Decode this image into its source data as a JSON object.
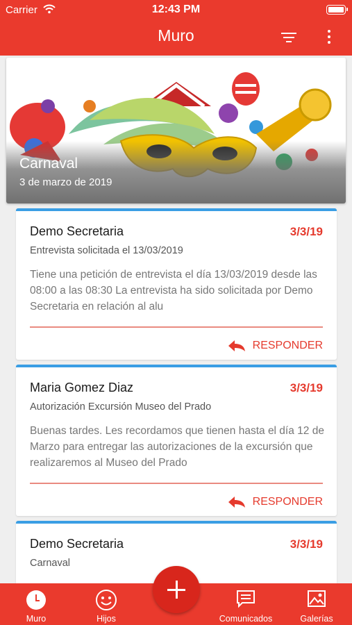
{
  "status_bar": {
    "carrier": "Carrier",
    "time": "12:43 PM"
  },
  "header": {
    "title": "Muro",
    "filter_icon": "filter-icon",
    "more_icon": "more-vertical-icon"
  },
  "banner": {
    "title": "Carnaval",
    "date": "3 de marzo de 2019"
  },
  "cards": [
    {
      "sender": "Demo Secretaria",
      "date": "3/3/19",
      "subject": "Entrevista solicitada el 13/03/2019",
      "body": "Tiene una petición de entrevista el día 13/03/2019 desde las 08:00 a las 08:30 La entrevista ha sido solicitada por Demo Secretaria en relación al alu",
      "action": "RESPONDER"
    },
    {
      "sender": "Maria Gomez Diaz",
      "date": "3/3/19",
      "subject": "Autorización Excursión Museo del Prado",
      "body": "Buenas tardes. Les recordamos que tienen hasta el día 12 de Marzo para entregar las autorizaciones de la excursión que realizaremos al Museo del Prado",
      "action": "RESPONDER"
    },
    {
      "sender": "Demo Secretaria",
      "date": "3/3/19",
      "subject": "Carnaval",
      "body": "",
      "action": ""
    }
  ],
  "tabs": [
    {
      "label": "Muro",
      "icon": "clock-icon"
    },
    {
      "label": "Hijos",
      "icon": "smiley-icon"
    },
    {
      "label": "Comunicados",
      "icon": "chat-icon"
    },
    {
      "label": "Galerías",
      "icon": "image-icon"
    }
  ],
  "colors": {
    "primary": "#ea3a2d",
    "accent_border": "#3a9ee4",
    "date_red": "#e53a2d"
  }
}
